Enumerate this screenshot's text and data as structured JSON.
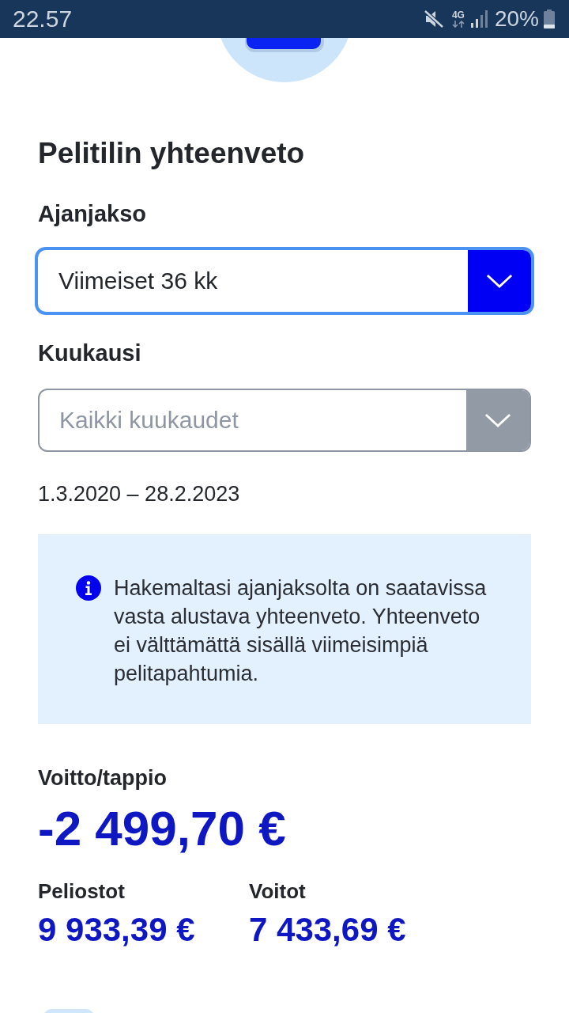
{
  "status_bar": {
    "time": "22.57",
    "network": "4G",
    "battery": "20%"
  },
  "title": "Pelitilin yhteenveto",
  "filters": [
    {
      "label": "Ajanjakso",
      "value": "Viimeiset 36 kk",
      "focused": true
    },
    {
      "label": "Kuukausi",
      "placeholder": "Kaikki kuukaudet",
      "focused": false
    }
  ],
  "date_range": "1.3.2020 – 28.2.2023",
  "notice": {
    "text": "Hakemaltasi ajanjaksolta on saatavissa vasta alustava yhteenveto. Yhteenveto ei välttämättä sisällä viimeisimpiä pelitapahtumia."
  },
  "result": {
    "label": "Voitto/tappio",
    "amount": "-2 499,70 €"
  },
  "stats": [
    {
      "label": "Peliostot",
      "value": "9 933,39 €"
    },
    {
      "label": "Voitot",
      "value": "7 433,69 €"
    }
  ]
}
